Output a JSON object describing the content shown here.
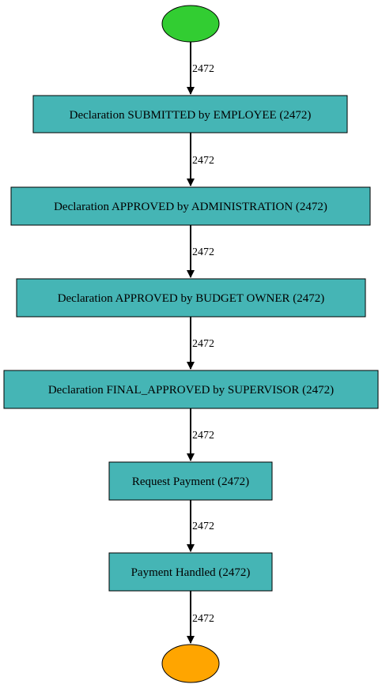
{
  "process_map": {
    "start_node": {
      "kind": "start",
      "color": "#32cd32"
    },
    "end_node": {
      "kind": "end",
      "color": "#ffa500"
    },
    "activity_color": "#45b5b5",
    "activities": [
      {
        "label": "Declaration SUBMITTED by EMPLOYEE (2472)"
      },
      {
        "label": "Declaration APPROVED by ADMINISTRATION (2472)"
      },
      {
        "label": "Declaration APPROVED by BUDGET OWNER (2472)"
      },
      {
        "label": "Declaration FINAL_APPROVED by SUPERVISOR (2472)"
      },
      {
        "label": "Request Payment (2472)"
      },
      {
        "label": "Payment Handled (2472)"
      }
    ],
    "edges": [
      {
        "label": "2472"
      },
      {
        "label": "2472"
      },
      {
        "label": "2472"
      },
      {
        "label": "2472"
      },
      {
        "label": "2472"
      },
      {
        "label": "2472"
      },
      {
        "label": "2472"
      }
    ]
  }
}
